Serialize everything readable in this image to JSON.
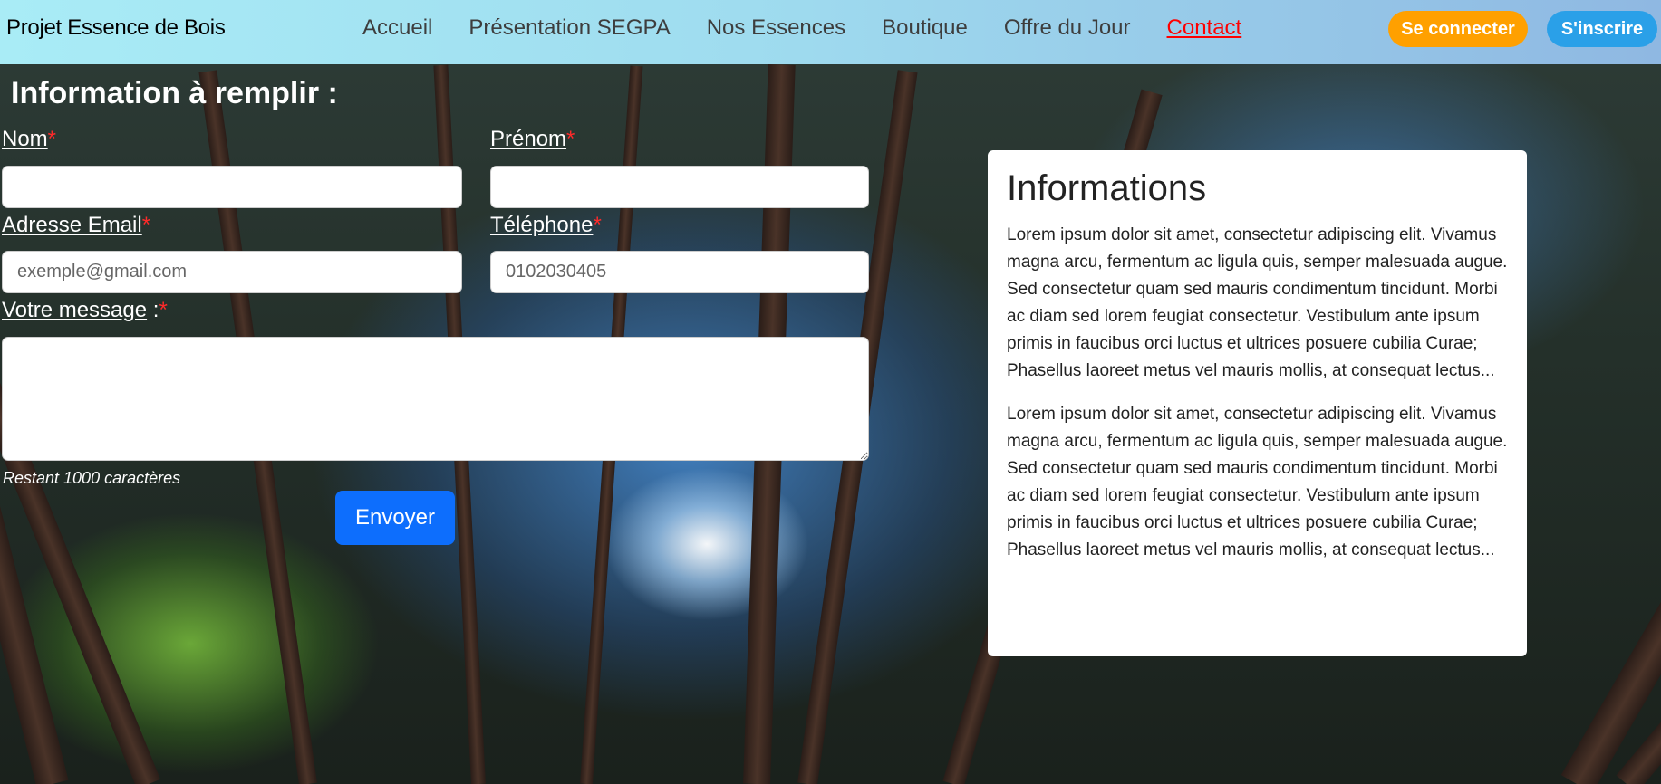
{
  "header": {
    "brand": "Projet Essence de Bois",
    "nav": [
      {
        "label": "Accueil"
      },
      {
        "label": "Présentation SEGPA"
      },
      {
        "label": "Nos Essences"
      },
      {
        "label": "Boutique"
      },
      {
        "label": "Offre du Jour"
      },
      {
        "label": "Contact"
      }
    ],
    "active_nav": "Contact",
    "login_label": "Se connecter",
    "signup_label": "S'inscrire"
  },
  "form": {
    "title": "Information à remplir :",
    "nom_label": "Nom",
    "prenom_label": "Prénom",
    "email_label": "Adresse Email",
    "email_placeholder": "exemple@gmail.com",
    "telephone_label": "Téléphone",
    "telephone_placeholder": "0102030405",
    "message_label": "Votre message",
    "message_suffix": " :",
    "required_mark": "*",
    "remaining": "Restant 1000 caractères",
    "submit_label": "Envoyer"
  },
  "info": {
    "title": "Informations",
    "paragraphs": [
      "Lorem ipsum dolor sit amet, consectetur adipiscing elit. Vivamus magna arcu, fermentum ac ligula quis, semper malesuada augue. Sed consectetur quam sed mauris condimentum tincidunt. Morbi ac diam sed lorem feugiat consectetur. Vestibulum ante ipsum primis in faucibus orci luctus et ultrices posuere cubilia Curae; Phasellus laoreet metus vel mauris mollis, at consequat lectus...",
      "Lorem ipsum dolor sit amet, consectetur adipiscing elit. Vivamus magna arcu, fermentum ac ligula quis, semper malesuada augue. Sed consectetur quam sed mauris condimentum tincidunt. Morbi ac diam sed lorem feugiat consectetur. Vestibulum ante ipsum primis in faucibus orci luctus et ultrices posuere cubilia Curae; Phasellus laoreet metus vel mauris mollis, at consequat lectus..."
    ]
  },
  "colors": {
    "active_nav": "#ff0000",
    "login_button": "#ffa000",
    "signup_button": "#2aa0e8",
    "submit_button": "#0d6efd",
    "required_mark": "#ff2a2a"
  }
}
